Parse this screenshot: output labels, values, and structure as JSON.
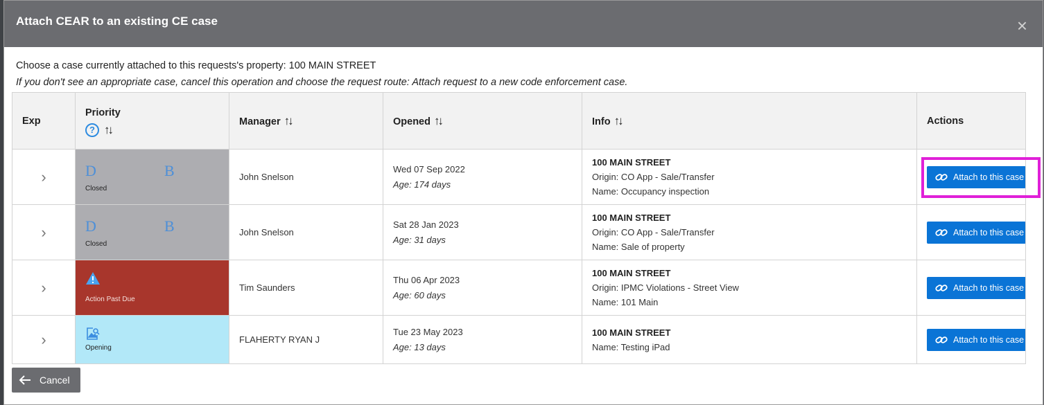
{
  "dialog": {
    "title": "Attach CEAR to an existing CE case",
    "close_glyph": "×"
  },
  "intro": {
    "line1": "Choose a case currently attached to this requests's property: 100 MAIN STREET",
    "line2": "If you don't see an appropriate case, cancel this operation and choose the request route: Attach request to a new code enforcement case."
  },
  "columns": {
    "exp": "Exp",
    "priority": "Priority",
    "manager": "Manager",
    "opened": "Opened",
    "info": "Info",
    "actions": "Actions",
    "help_glyph": "?",
    "sort_glyph": "↑↓"
  },
  "rows": [
    {
      "status": "closed",
      "priority_left": "D",
      "priority_right": "B",
      "priority_caption": "Closed",
      "manager": "John Snelson",
      "opened_date": "Wed 07 Sep 2022",
      "age": "Age: 174 days",
      "info_address": "100 MAIN STREET",
      "info_origin": "Origin: CO App - Sale/Transfer",
      "info_name": "Name: Occupancy inspection",
      "action_label": "Attach to this case"
    },
    {
      "status": "closed",
      "priority_left": "D",
      "priority_right": "B",
      "priority_caption": "Closed",
      "manager": "John Snelson",
      "opened_date": "Sat 28 Jan 2023",
      "age": "Age: 31 days",
      "info_address": "100 MAIN STREET",
      "info_origin": "Origin: CO App - Sale/Transfer",
      "info_name": "Name: Sale of property",
      "action_label": "Attach to this case"
    },
    {
      "status": "pastdue",
      "priority_caption": "Action Past Due",
      "manager": "Tim Saunders",
      "opened_date": "Thu 06 Apr 2023",
      "age": "Age: 60 days",
      "info_address": "100 MAIN STREET",
      "info_origin": "Origin: IPMC Violations - Street View",
      "info_name": "Name: 101 Main",
      "action_label": "Attach to this case"
    },
    {
      "status": "opening",
      "priority_caption": "Opening",
      "manager": "FLAHERTY RYAN J",
      "opened_date": "Tue 23 May 2023",
      "age": "Age: 13 days",
      "info_address": "100 MAIN STREET",
      "info_name": "Name: Testing iPad",
      "action_label": "Attach to this case"
    }
  ],
  "footer": {
    "cancel_label": "Cancel"
  },
  "colors": {
    "header_bg": "#6b6c70",
    "closed_bg": "#adadb1",
    "pastdue_bg": "#a8362c",
    "opening_bg": "#b2e8f8",
    "accent_blue": "#0a74d6",
    "highlight": "#e020d8"
  }
}
